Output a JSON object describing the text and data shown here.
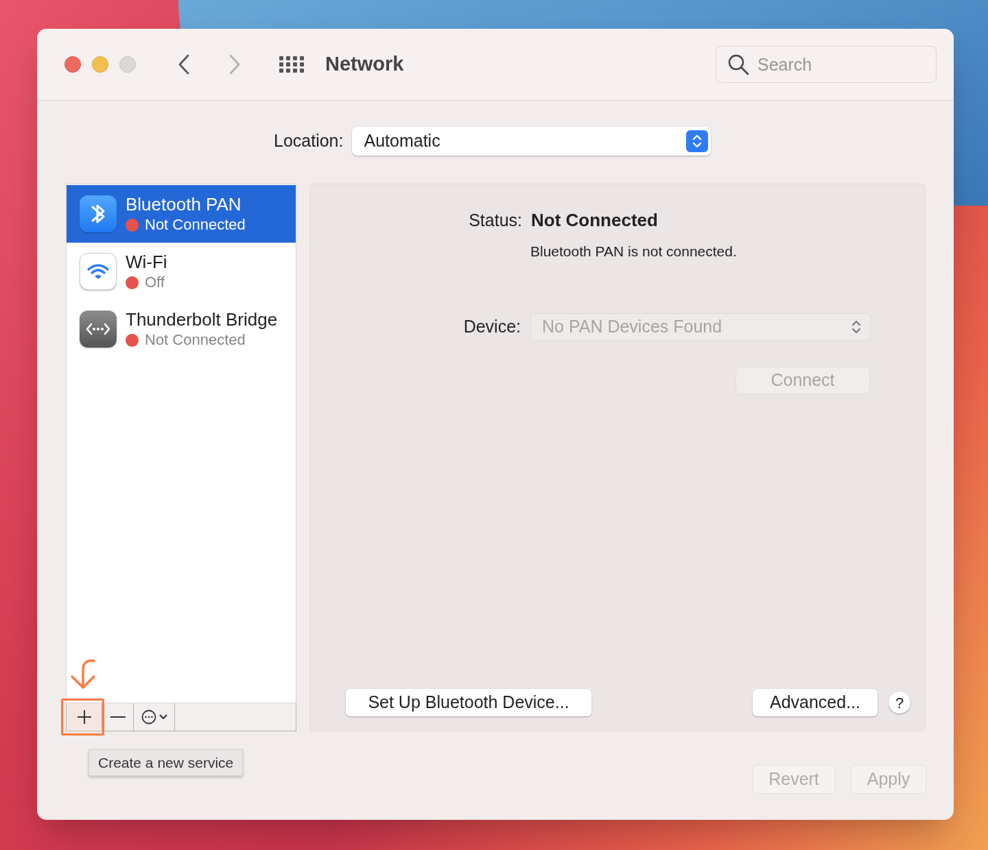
{
  "window": {
    "title": "Network"
  },
  "nav": {
    "back_disabled": false,
    "forward_disabled": true
  },
  "search": {
    "placeholder": "Search"
  },
  "location": {
    "label": "Location:",
    "value": "Automatic"
  },
  "services": [
    {
      "kind": "bluetooth",
      "name": "Bluetooth PAN",
      "status": "Not Connected",
      "color": "#e5534b",
      "selected": true
    },
    {
      "kind": "wifi",
      "name": "Wi-Fi",
      "status": "Off",
      "color": "#e5534b",
      "selected": false
    },
    {
      "kind": "thunderbolt",
      "name": "Thunderbolt Bridge",
      "status": "Not Connected",
      "color": "#e5534b",
      "selected": false
    }
  ],
  "detail": {
    "status_label": "Status:",
    "status_value": "Not Connected",
    "description": "Bluetooth PAN is not connected.",
    "device_label": "Device:",
    "device_value": "No PAN Devices Found",
    "device_disabled": true,
    "connect": {
      "label": "Connect",
      "disabled": true
    },
    "setup_button": "Set Up Bluetooth Device...",
    "advanced_button": "Advanced...",
    "help_button": "?"
  },
  "tooltip": "Create a new service",
  "footer_buttons": [
    {
      "label": "Revert",
      "disabled": true
    },
    {
      "label": "Apply",
      "disabled": true
    }
  ]
}
